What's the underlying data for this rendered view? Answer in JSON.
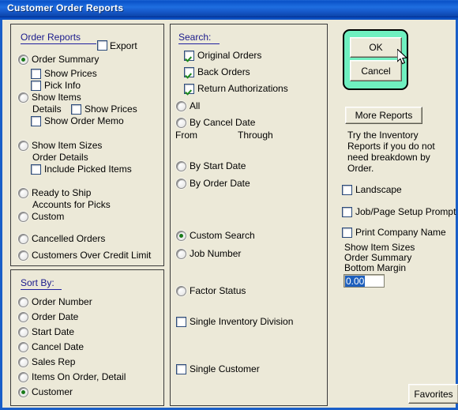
{
  "window": {
    "title": "Customer Order Reports"
  },
  "order_reports": {
    "group_title": "Order Reports",
    "export_label": "Export",
    "export_checked": false,
    "options": [
      {
        "label": "Order Summary",
        "selected": true
      },
      {
        "label": "Show Items",
        "selected": false
      },
      {
        "label": "Show Item Sizes",
        "selected": false
      },
      {
        "label": "Ready to Ship",
        "selected": false
      },
      {
        "label": "Custom",
        "selected": false
      },
      {
        "label": "Cancelled Orders",
        "selected": false
      },
      {
        "label": "Customers Over Credit Limit",
        "selected": false
      }
    ],
    "show_prices_1": "Show Prices",
    "pick_info": "Pick Info",
    "details_label": "Details",
    "show_prices_2": "Show Prices",
    "show_order_memo": "Show Order Memo",
    "order_details_label": "Order Details",
    "include_picked_items": "Include Picked Items",
    "accounts_for_picks_label": "Accounts for Picks"
  },
  "sort_by": {
    "group_title": "Sort By:",
    "options": [
      {
        "label": "Order Number",
        "selected": false
      },
      {
        "label": "Order Date",
        "selected": false
      },
      {
        "label": "Start Date",
        "selected": false
      },
      {
        "label": "Cancel Date",
        "selected": false
      },
      {
        "label": "Sales Rep",
        "selected": false
      },
      {
        "label": "Items On Order, Detail",
        "selected": false
      },
      {
        "label": "Customer",
        "selected": true
      }
    ]
  },
  "search": {
    "group_title": "Search:",
    "checkboxes": [
      {
        "label": "Original Orders",
        "checked": true
      },
      {
        "label": "Back Orders",
        "checked": true
      },
      {
        "label": "Return Authorizations",
        "checked": true
      }
    ],
    "radios": [
      {
        "label": "All",
        "selected": false
      },
      {
        "label": "By Cancel Date",
        "selected": false
      },
      {
        "label": "By Start Date",
        "selected": false
      },
      {
        "label": "By Order Date",
        "selected": false
      },
      {
        "label": "Custom Search",
        "selected": true
      },
      {
        "label": "Job Number",
        "selected": false
      },
      {
        "label": "Factor Status",
        "selected": false
      }
    ],
    "from_label": "From",
    "through_label": "Through",
    "single_inventory_division": {
      "label": "Single Inventory Division",
      "checked": false
    },
    "single_customer": {
      "label": "Single Customer",
      "checked": false
    }
  },
  "actions": {
    "ok_label": "OK",
    "cancel_label": "Cancel",
    "more_reports_label": "More Reports",
    "hint_line1": "Try the Inventory",
    "hint_line2": "Reports if you do not",
    "hint_line3": "need breakdown by",
    "hint_line4": "Order.",
    "landscape": {
      "label": "Landscape",
      "checked": false
    },
    "job_page_setup_prompt": {
      "label": "Job/Page Setup Prompt",
      "checked": false
    },
    "print_company_name": {
      "label": "Print Company Name",
      "checked": false
    },
    "margin_line1": "Show Item Sizes",
    "margin_line2": "Order Summary",
    "margin_line3": "Bottom Margin",
    "margin_value": "0.00",
    "favorites_label": "Favorites"
  },
  "colors": {
    "titlebar": "#1557c8",
    "face": "#ece9d8",
    "group_title": "#1a1a8c",
    "default_button_glow": "#6ff0c0",
    "check_mark": "#1d8a1d",
    "radio_dot": "#1a7a1a",
    "selection": "#1d5fbd"
  }
}
